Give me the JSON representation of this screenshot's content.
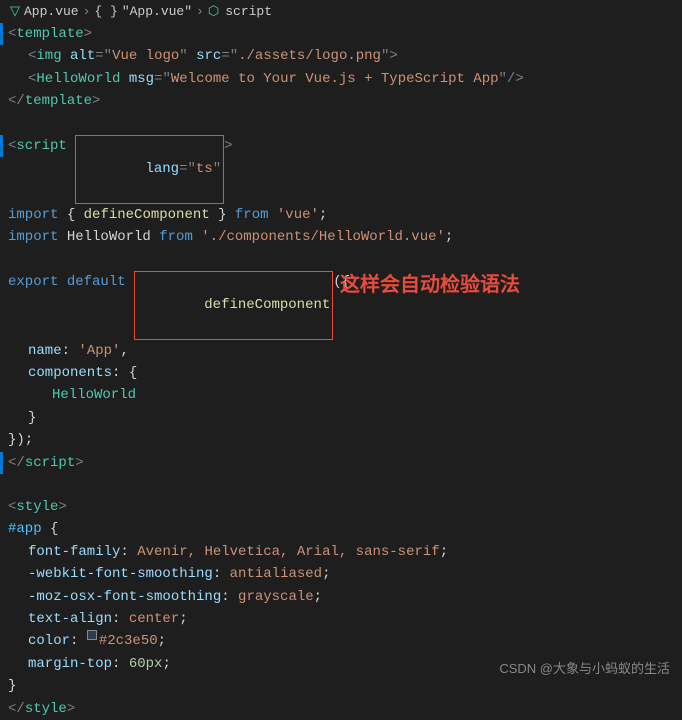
{
  "breadcrumb": {
    "app_vue": "App.vue",
    "obj": "{ }",
    "quote": "\"App.vue\"",
    "script": "script"
  },
  "footer": {
    "text": "CSDN @大象与小蚂蚁的生活"
  },
  "annotation": {
    "text": "这样会自动检验语法"
  }
}
